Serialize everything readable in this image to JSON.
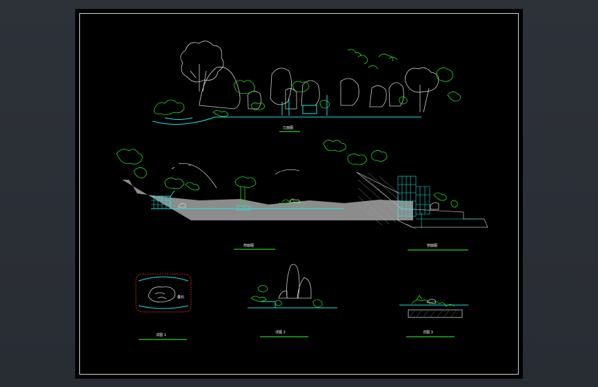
{
  "colors": {
    "background": "#2b2f36",
    "paper": "#000000",
    "frame": "#d8d8d8",
    "vegetation": "#22e01a",
    "water": "#1fe6e6",
    "rock": "#cfcfcf",
    "ground": "#8c8c8c",
    "border_red": "#e0201a"
  },
  "views": {
    "elevation_main": {
      "label": "立面图"
    },
    "section_a": {
      "label": "剖面图"
    },
    "section_b": {
      "label": "剖面图"
    },
    "detail_1": {
      "label": "详图 1",
      "callout": "叠石"
    },
    "detail_2": {
      "label": "详图 2"
    },
    "detail_3": {
      "label": "详图 3"
    }
  }
}
